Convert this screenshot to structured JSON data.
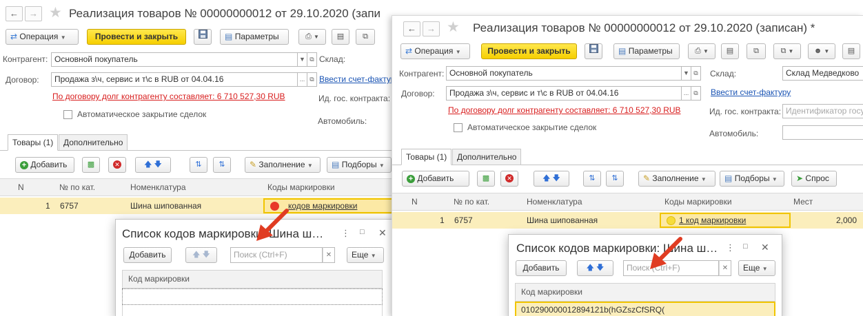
{
  "left_window": {
    "title": "Реализация товаров № 00000000012 от 29.10.2020 (запи",
    "toolbar": {
      "operation": "Операция",
      "post_close": "Провести и закрыть",
      "parameters": "Параметры"
    },
    "form": {
      "counterparty_label": "Контрагент:",
      "counterparty_value": "Основной покупатель",
      "warehouse_label": "Склад:",
      "contract_label": "Договор:",
      "contract_value": "Продажа з\\ч, сервис и т\\с в RUB от 04.04.16",
      "invoice_link": "Ввести счет-фактуру",
      "debt_link": "По договору долг контрагенту составляет: 6 710 527,30 RUB",
      "gov_contract_label": "Ид. гос. контракта:",
      "auto_close_label": "Автоматическое закрытие сделок",
      "car_label": "Автомобиль:"
    },
    "tabs": [
      "Товары (1)",
      "Дополнительно"
    ],
    "table_toolbar": {
      "add": "Добавить",
      "fill": "Заполнение",
      "selections": "Подборы"
    },
    "table": {
      "columns": [
        "N",
        "№ по кат.",
        "Номенклатура",
        "Коды маркировки"
      ],
      "rows": [
        {
          "n": "1",
          "cat": "6757",
          "item": "Шина шипованная",
          "codes": "кодов маркировки"
        }
      ]
    },
    "dialog": {
      "title": "Список кодов маркировки: Шина ш…",
      "add": "Добавить",
      "search_placeholder": "Поиск (Ctrl+F)",
      "more": "Еще",
      "column": "Код маркировки"
    }
  },
  "right_window": {
    "title": "Реализация товаров № 00000000012 от 29.10.2020 (записан) *",
    "toolbar": {
      "operation": "Операция",
      "post_close": "Провести и закрыть",
      "parameters": "Параметры"
    },
    "form": {
      "counterparty_label": "Контрагент:",
      "counterparty_value": "Основной покупатель",
      "warehouse_label": "Склад:",
      "warehouse_value": "Склад Медведково",
      "contract_label": "Договор:",
      "contract_value": "Продажа з\\ч, сервис и т\\с в RUB от 04.04.16",
      "invoice_link": "Ввести счет-фактуру",
      "debt_link": "По договору долг контрагенту составляет: 6 710 527,30 RUB",
      "gov_contract_label": "Ид. гос. контракта:",
      "gov_contract_placeholder": "Идентификатор госу",
      "auto_close_label": "Автоматическое закрытие сделок",
      "car_label": "Автомобиль:"
    },
    "tabs": [
      "Товары (1)",
      "Дополнительно"
    ],
    "table_toolbar": {
      "add": "Добавить",
      "fill": "Заполнение",
      "selections": "Подборы",
      "demand": "Спрос"
    },
    "table": {
      "columns": [
        "N",
        "№ по кат.",
        "Номенклатура",
        "Коды маркировки",
        "Мест"
      ],
      "rows": [
        {
          "n": "1",
          "cat": "6757",
          "item": "Шина шипованная",
          "codes": "1 код маркировки",
          "places": "2,000"
        }
      ]
    },
    "dialog": {
      "title": "Список кодов маркировки: Шина ш…",
      "add": "Добавить",
      "search_placeholder": "Поиск (Ctrl+F)",
      "more": "Еще",
      "column": "Код маркировки",
      "rows": [
        "010290000012894121b(hGZszCfSRQ("
      ]
    }
  },
  "colors": {
    "accent_yellow": "#f6cf00",
    "link_blue": "#1a54b4",
    "debt_red": "#d81d1d",
    "status_red": "#e8392a",
    "status_yellow": "#f6dc3a",
    "delete_red": "#d02a2a",
    "add_green": "#3b9e3b",
    "arrow_red": "#e03c22"
  }
}
